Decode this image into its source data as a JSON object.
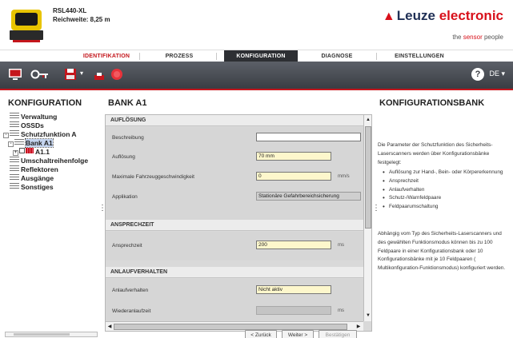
{
  "device": {
    "model": "RSL440-XL",
    "range_label": "Reichweite: 8,25 m"
  },
  "brand": {
    "logo_part1": "Leuze",
    "logo_part2": "electronic",
    "tagline_part1": "the",
    "tagline_part2": "sensor",
    "tagline_part3": "people",
    "accent_color": "#c4161c",
    "navy_color": "#1f2f55"
  },
  "tabs": [
    {
      "label": "IDENTIFIKATION",
      "active": false
    },
    {
      "label": "PROZESS",
      "active": false
    },
    {
      "label": "KONFIGURATION",
      "active": true
    },
    {
      "label": "DIAGNOSE",
      "active": false
    },
    {
      "label": "EINSTELLUNGEN",
      "active": false
    }
  ],
  "toolbar": {
    "icons": [
      "monitor-icon",
      "connect-icon",
      "save-icon",
      "print-icon",
      "record-icon"
    ],
    "help_label": "?",
    "language": "DE"
  },
  "tree": {
    "title": "KONFIGURATION",
    "items": [
      {
        "label": "Verwaltung",
        "level": 0,
        "expander": ""
      },
      {
        "label": "OSSDs",
        "level": 0,
        "expander": ""
      },
      {
        "label": "Schutzfunktion A",
        "level": 0,
        "expander": "-"
      },
      {
        "label": "Bank A1",
        "level": 1,
        "expander": "-",
        "selected": true
      },
      {
        "label": "A1.1",
        "level": 2,
        "expander": "+"
      },
      {
        "label": "Umschaltreihenfolge",
        "level": 0,
        "expander": ""
      },
      {
        "label": "Reflektoren",
        "level": 0,
        "expander": ""
      },
      {
        "label": "Ausgänge",
        "level": 0,
        "expander": ""
      },
      {
        "label": "Sonstiges",
        "level": 0,
        "expander": ""
      }
    ]
  },
  "form": {
    "title": "BANK A1",
    "sections": {
      "aufloesung": {
        "heading": "AUFLÖSUNG",
        "rows": [
          {
            "label": "Beschreibung",
            "value": "",
            "unit": ""
          },
          {
            "label": "Auflösung",
            "value": "70 mm",
            "unit": ""
          },
          {
            "label": "Maximale Fahrzeuggeschwindigkeit",
            "value": "0",
            "unit": "mm/s"
          },
          {
            "label": "Applikation",
            "value": "Stationäre Gefahrbereichsicherung",
            "unit": ""
          }
        ]
      },
      "ansprechzeit": {
        "heading": "ANSPRECHZEIT",
        "rows": [
          {
            "label": "Ansprechzeit",
            "value": "200",
            "unit": "ms"
          }
        ]
      },
      "anlaufverhalten": {
        "heading": "ANLAUFVERHALTEN",
        "rows": [
          {
            "label": "Anlaufverhalten",
            "value": "Nicht aktiv",
            "unit": ""
          },
          {
            "label": "Wiederanlaufzeit",
            "value": "",
            "unit": "ms"
          }
        ]
      }
    },
    "buttons": {
      "back": "< Zurück",
      "next": "Weiter >",
      "confirm": "Bestätigen"
    }
  },
  "info": {
    "title": "KONFIGURATIONSBANK",
    "intro": "Die Parameter der Schutzfunktion des Sicherheits-Laserscanners werden über Konfigurationsbänke festgelegt:",
    "bullets": [
      "Auflösung zur Hand-, Bein- oder Körpererkennung",
      "Ansprechzeit",
      "Anlaufverhalten",
      "Schutz-/Warnfeldpaare",
      "Feldpaarumschaltung"
    ],
    "paragraph2": "Abhängig vom Typ des Sicherheits-Laserscanners und des gewählten Funktionsmodus können bis zu 100 Feldpaare in einer Konfigurationsbank oder 10 Konfigurationsbänke mit je 10 Feldpaaren ( Multikonfiguration-Funktionsmodus) konfiguriert werden."
  }
}
